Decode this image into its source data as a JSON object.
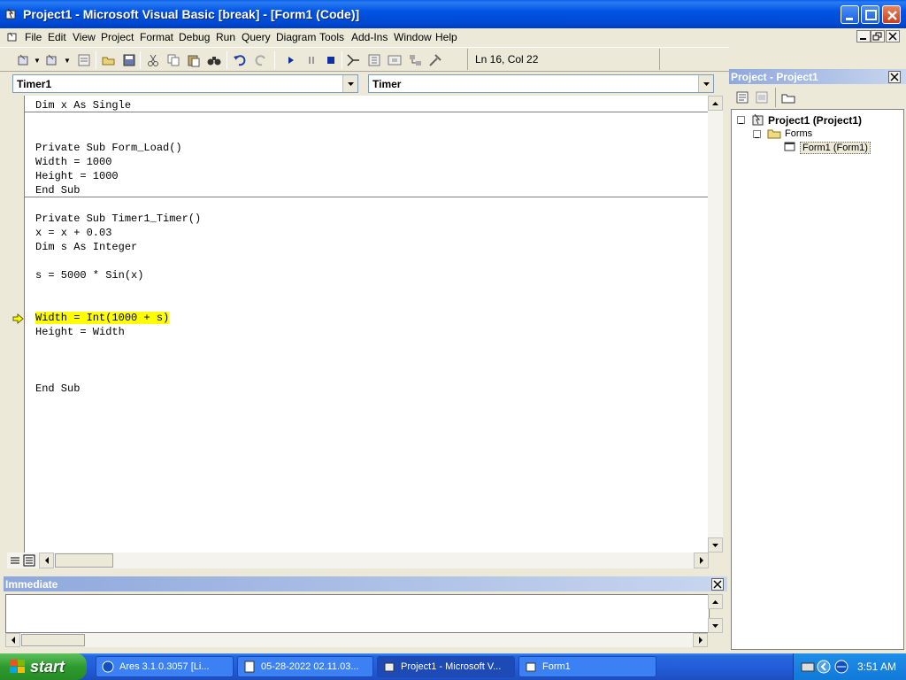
{
  "window": {
    "title": "Project1 - Microsoft Visual Basic [break] - [Form1 (Code)]"
  },
  "menu": {
    "items": [
      "File",
      "Edit",
      "View",
      "Project",
      "Format",
      "Debug",
      "Run",
      "Query",
      "Diagram",
      "Tools",
      "Add-Ins",
      "Window",
      "Help"
    ]
  },
  "toolbar": {
    "status": "Ln 16, Col 22"
  },
  "code_window": {
    "object_combo": "Timer1",
    "procedure_combo": "Timer",
    "lines": [
      "Dim x As Single",
      "",
      "",
      "Private Sub Form_Load()",
      "Width = 1000",
      "Height = 1000",
      "End Sub",
      "",
      "Private Sub Timer1_Timer()",
      "x = x + 0.03",
      "Dim s As Integer",
      "",
      "s = 5000 * Sin(x)",
      "",
      "",
      "Width = Int(1000 + s)",
      "Height = Width",
      "",
      "",
      "",
      "End Sub"
    ],
    "highlighted_line": "Width = Int(1000 + s)"
  },
  "immediate": {
    "title": "Immediate"
  },
  "project_panel": {
    "title": "Project - Project1",
    "root": "Project1 (Project1)",
    "folder": "Forms",
    "item": "Form1 (Form1)"
  },
  "taskbar": {
    "start_label": "start",
    "tasks": [
      "Ares 3.1.0.3057   [Li...",
      "05-28-2022 02.11.03...",
      "Project1 - Microsoft V...",
      "Form1"
    ],
    "clock": "3:51 AM"
  },
  "colors": {
    "title_blue": "#0054e3",
    "highlight": "#ffff00"
  }
}
